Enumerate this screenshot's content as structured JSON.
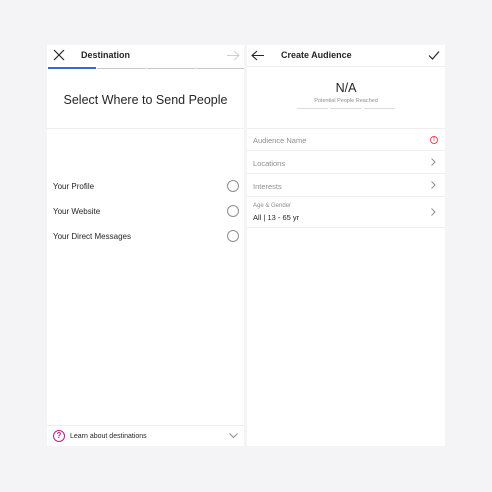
{
  "destination": {
    "title": "Destination",
    "heading": "Select Where to Send People",
    "options": [
      {
        "label": "Your Profile"
      },
      {
        "label": "Your Website"
      },
      {
        "label": "Your Direct Messages"
      }
    ],
    "learn_link": "Learn about destinations",
    "progress_steps": 4,
    "progress_active": 1
  },
  "audience": {
    "title": "Create Audience",
    "reach_value": "N/A",
    "reach_label": "Potential People Reached",
    "fields": [
      {
        "label": "Audience Name",
        "value": "",
        "trailing": "alert-icon"
      },
      {
        "label": "Locations",
        "value": "",
        "trailing": "chevron-right-icon"
      },
      {
        "label": "Interests",
        "value": "",
        "trailing": "chevron-right-icon"
      },
      {
        "label": "Age & Gender",
        "value": "All | 13 - 65 yr",
        "trailing": "chevron-right-icon"
      }
    ]
  },
  "colors": {
    "accent_blue": "#3b68d8",
    "learn_icon": "#b4238f",
    "alert_red": "#ed4956",
    "page_bg": "#f4f4f6"
  }
}
